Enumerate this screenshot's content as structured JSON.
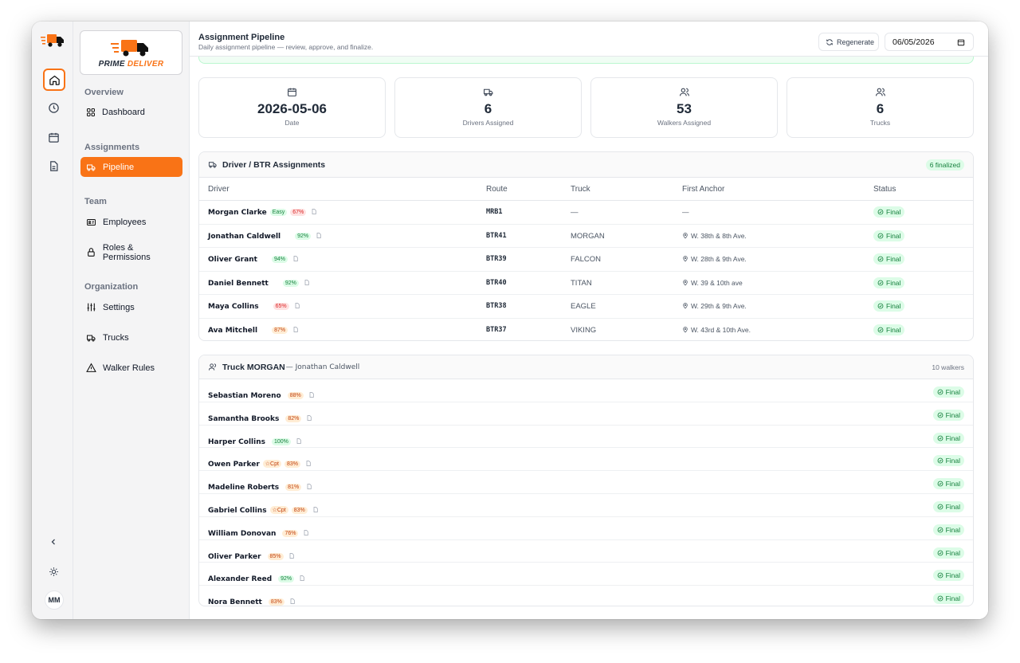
{
  "brand": {
    "name_part1": "PRIME",
    "name_part2": "DELIVER"
  },
  "rail": {
    "user_initials": "MM"
  },
  "sidebar": {
    "sections": [
      {
        "label": "Overview"
      },
      {
        "label": "Assignments"
      },
      {
        "label": "Team"
      },
      {
        "label": "Organization"
      }
    ],
    "items": [
      {
        "label": "Dashboard",
        "icon": "grid-icon"
      },
      {
        "label": "Pipeline",
        "icon": "truck-icon",
        "active": true
      },
      {
        "label": "Employees",
        "icon": "id-card-icon"
      },
      {
        "label": "Roles & Permissions",
        "icon": "lock-icon"
      },
      {
        "label": "Settings",
        "icon": "sliders-icon"
      },
      {
        "label": "Trucks",
        "icon": "truck-icon"
      },
      {
        "label": "Walker Rules",
        "icon": "warning-icon"
      }
    ]
  },
  "header": {
    "title": "Assignment Pipeline",
    "subtitle": "Daily assignment pipeline — review, approve, and finalize.",
    "regenerate_label": "Regenerate",
    "date_value": "06/05/2026"
  },
  "stats": [
    {
      "value": "2026-05-06",
      "label": "Date",
      "icon": "calendar-icon"
    },
    {
      "value": "6",
      "label": "Drivers Assigned",
      "icon": "truck-icon"
    },
    {
      "value": "53",
      "label": "Walkers Assigned",
      "icon": "users-icon"
    },
    {
      "value": "6",
      "label": "Trucks",
      "icon": "users-icon"
    }
  ],
  "drivers": {
    "title": "Driver / BTR Assignments",
    "badge": "6 finalized",
    "columns": {
      "driver": "Driver",
      "route": "Route",
      "truck": "Truck",
      "anchor": "First Anchor",
      "status": "Status"
    },
    "rows": [
      {
        "name": "Morgan Clarke",
        "tag": "Easy",
        "pct": "67%",
        "pct_color": "red",
        "route": "MRB1",
        "truck": "—",
        "anchor": "—",
        "status": "Final"
      },
      {
        "name": "Jonathan Caldwell",
        "tag": "",
        "pct": "92%",
        "pct_color": "green",
        "route": "BTR41",
        "truck": "MORGAN",
        "anchor": "W. 38th & 8th Ave.",
        "status": "Final"
      },
      {
        "name": "Oliver Grant",
        "tag": "",
        "pct": "94%",
        "pct_color": "green",
        "route": "BTR39",
        "truck": "FALCON",
        "anchor": "W. 28th & 9th Ave.",
        "status": "Final"
      },
      {
        "name": "Daniel Bennett",
        "tag": "",
        "pct": "92%",
        "pct_color": "green",
        "route": "BTR40",
        "truck": "TITAN",
        "anchor": "W. 39 & 10th ave",
        "status": "Final"
      },
      {
        "name": "Maya Collins",
        "tag": "",
        "pct": "65%",
        "pct_color": "red",
        "route": "BTR38",
        "truck": "EAGLE",
        "anchor": "W. 29th & 9th Ave.",
        "status": "Final"
      },
      {
        "name": "Ava Mitchell",
        "tag": "",
        "pct": "87%",
        "pct_color": "orange",
        "route": "BTR37",
        "truck": "VIKING",
        "anchor": "W. 43rd & 10th Ave.",
        "status": "Final"
      }
    ]
  },
  "truck_panel": {
    "title": "Truck MORGAN",
    "driver": "— Jonathan Caldwell",
    "count": "10 walkers",
    "walkers": [
      {
        "name": "Sebastian Moreno",
        "cpt": "",
        "pct": "88%",
        "pct_color": "orange",
        "status": "Final"
      },
      {
        "name": "Samantha Brooks",
        "cpt": "",
        "pct": "82%",
        "pct_color": "orange",
        "status": "Final"
      },
      {
        "name": "Harper Collins",
        "cpt": "",
        "pct": "100%",
        "pct_color": "green",
        "status": "Final"
      },
      {
        "name": "Owen Parker",
        "cpt": "☆Cpt",
        "pct": "83%",
        "pct_color": "orange",
        "status": "Final"
      },
      {
        "name": "Madeline Roberts",
        "cpt": "",
        "pct": "81%",
        "pct_color": "orange",
        "status": "Final"
      },
      {
        "name": "Gabriel Collins",
        "cpt": "☆Cpt",
        "pct": "83%",
        "pct_color": "orange",
        "status": "Final"
      },
      {
        "name": "William Donovan",
        "cpt": "",
        "pct": "76%",
        "pct_color": "orange",
        "status": "Final"
      },
      {
        "name": "Oliver Parker",
        "cpt": "",
        "pct": "85%",
        "pct_color": "orange",
        "status": "Final"
      },
      {
        "name": "Alexander Reed",
        "cpt": "",
        "pct": "92%",
        "pct_color": "green",
        "status": "Final"
      },
      {
        "name": "Nora Bennett",
        "cpt": "",
        "pct": "83%",
        "pct_color": "orange",
        "status": "Final"
      }
    ]
  },
  "colors": {
    "accent": "#f97316",
    "final_green": "#15803d"
  }
}
